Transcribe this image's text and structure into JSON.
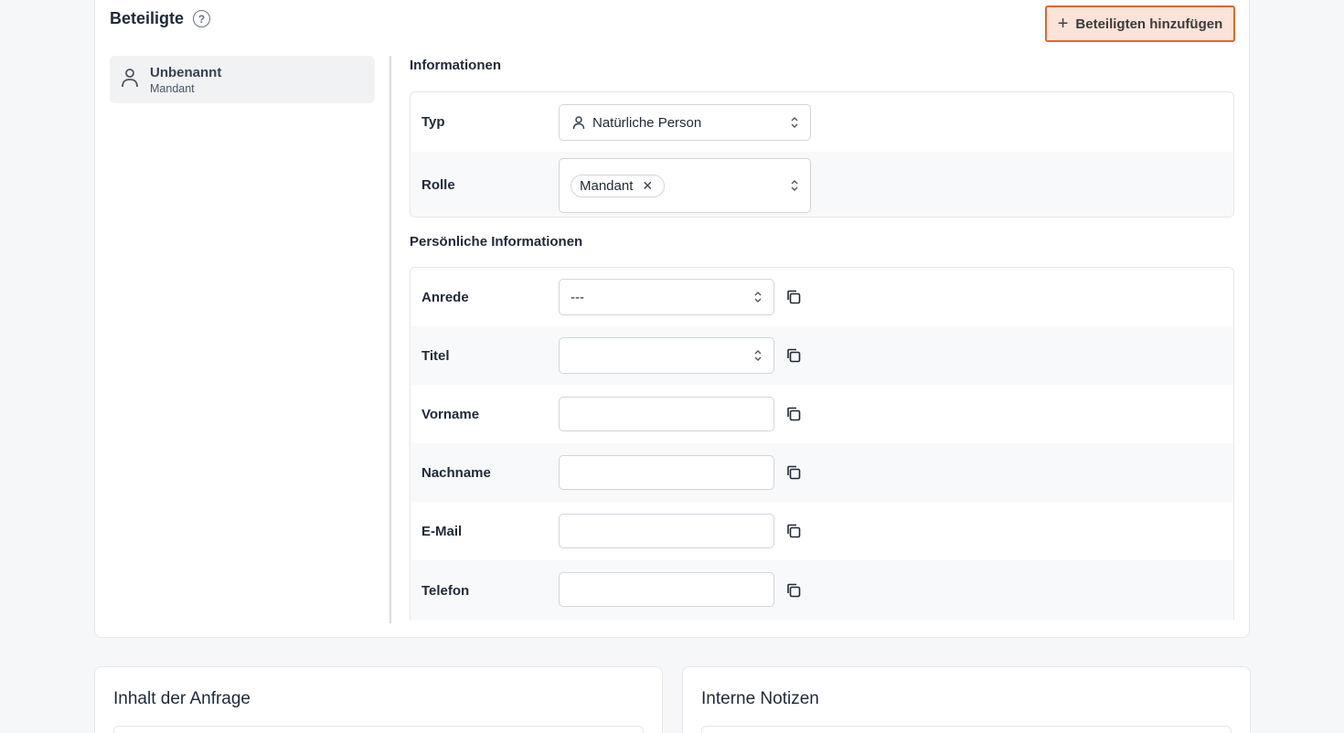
{
  "section": {
    "title": "Beteiligte",
    "help_icon": "question-circle-icon",
    "add_button": "Beteiligten hinzufügen"
  },
  "parties": [
    {
      "name": "Unbenannt",
      "role": "Mandant",
      "icon": "user-icon"
    }
  ],
  "info": {
    "heading": "Informationen",
    "typ_label": "Typ",
    "typ_value": "Natürliche Person",
    "rolle_label": "Rolle",
    "rolle_chip": "Mandant"
  },
  "personal": {
    "heading": "Persönliche Informationen",
    "anrede_label": "Anrede",
    "anrede_value": "---",
    "titel_label": "Titel",
    "titel_value": "",
    "vorname_label": "Vorname",
    "nachname_label": "Nachname",
    "email_label": "E-Mail",
    "telefon_label": "Telefon"
  },
  "bottom": {
    "request_title": "Inhalt der Anfrage",
    "notes_title": "Interne Notizen"
  },
  "colors": {
    "accent_border": "#e0662c",
    "accent_bg": "#fbe3da"
  }
}
